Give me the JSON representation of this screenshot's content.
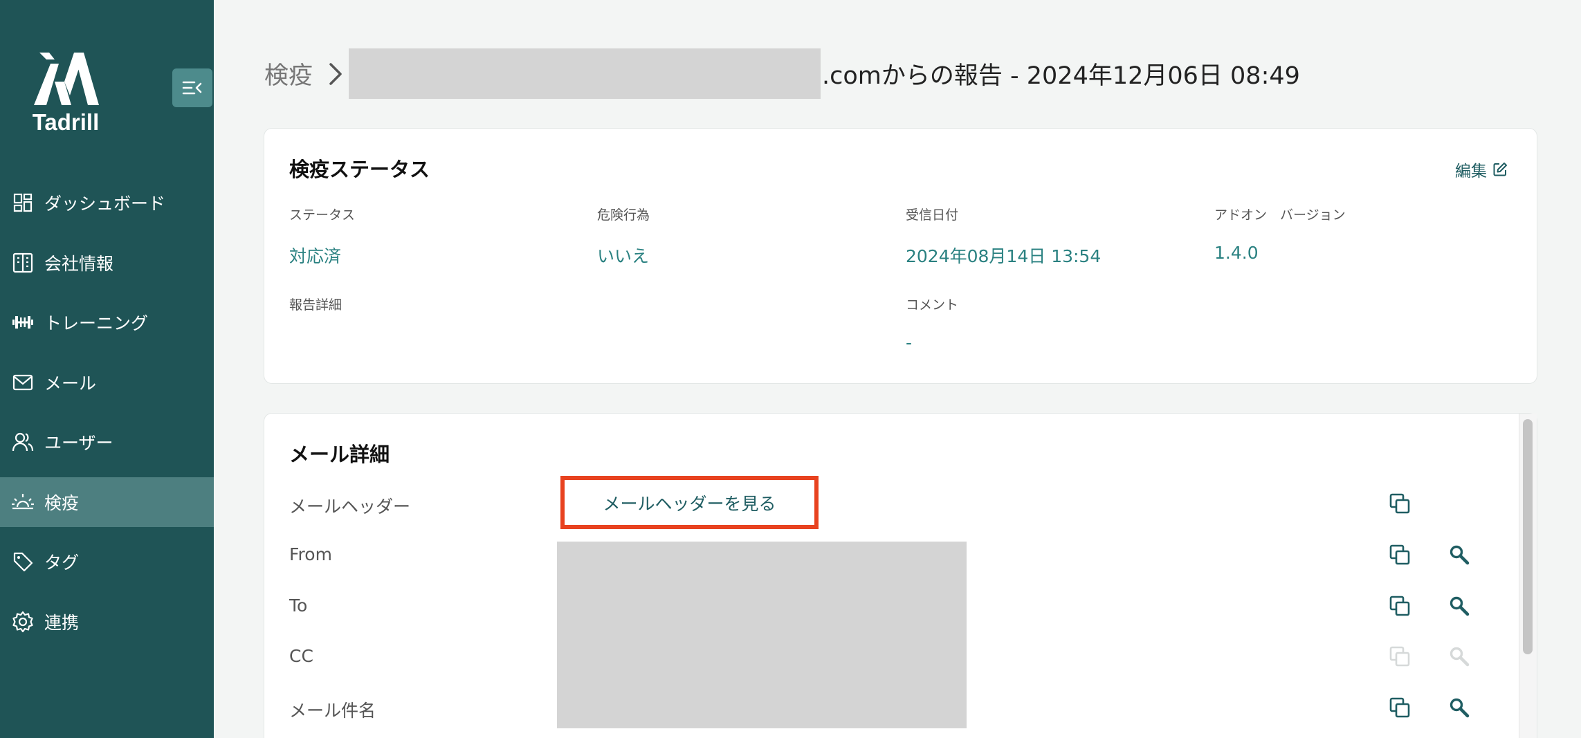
{
  "app": {
    "name": "Tadrill"
  },
  "sidebar": {
    "items": [
      {
        "label": "ダッシュボード",
        "icon": "dashboard-icon"
      },
      {
        "label": "会社情報",
        "icon": "building-icon"
      },
      {
        "label": "トレーニング",
        "icon": "dumbbell-icon"
      },
      {
        "label": "メール",
        "icon": "mail-icon"
      },
      {
        "label": "ユーザー",
        "icon": "users-icon"
      },
      {
        "label": "検疫",
        "icon": "quarantine-icon",
        "active": true
      },
      {
        "label": "タグ",
        "icon": "tag-icon"
      },
      {
        "label": "連携",
        "icon": "gear-icon"
      }
    ]
  },
  "header": {
    "breadcrumb_root": "検疫",
    "title_suffix": ".comからの報告 - 2024年12月06日 08:49"
  },
  "status_card": {
    "title": "検疫ステータス",
    "edit_label": "編集",
    "fields": {
      "status": {
        "label": "ステータス",
        "value": "対応済"
      },
      "risk": {
        "label": "危険行為",
        "value": "いいえ"
      },
      "received": {
        "label": "受信日付",
        "value": "2024年08月14日 13:54"
      },
      "addon": {
        "label": "アドオン　バージョン",
        "value": "1.4.0"
      },
      "detail": {
        "label": "報告詳細",
        "value": ""
      },
      "comment": {
        "label": "コメント",
        "value": "-"
      }
    }
  },
  "mail_card": {
    "title": "メール詳細",
    "rows": [
      {
        "label": "メールヘッダー"
      },
      {
        "label": "From"
      },
      {
        "label": "To"
      },
      {
        "label": "CC"
      },
      {
        "label": "メール件名"
      }
    ],
    "header_link": "メールヘッダーを見る"
  },
  "colors": {
    "sidebar_bg": "#1f5456",
    "active_item": "#4d7f80",
    "accent": "#2a8181",
    "highlight": "#e8421f"
  }
}
